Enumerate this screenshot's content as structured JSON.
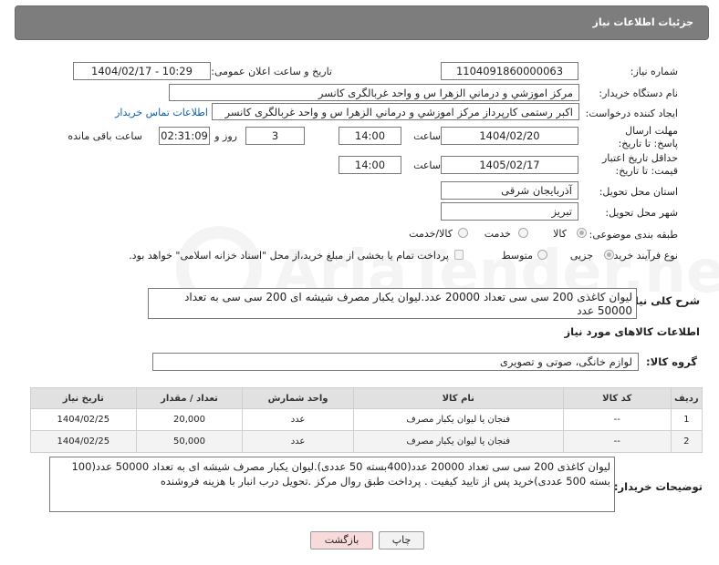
{
  "header": {
    "title": "جزئیات اطلاعات نیاز"
  },
  "fields": {
    "need_number_label": "شماره نیاز:",
    "need_number": "1104091860000063",
    "announce_label": "تاریخ و ساعت اعلان عمومی:",
    "announce_value": "1404/02/17 - 10:29",
    "buyer_org_label": "نام دستگاه خریدار:",
    "buyer_org": "مرکز اموزشي و درماني الزهرا س  و واحد غربالگری کانسر",
    "requester_label": "ایجاد کننده درخواست:",
    "requester": "اکبر رستمی کارپرداز مرکز اموزشي و درماني الزهرا س  و واحد غربالگری کانسر",
    "buyer_contact_link": "اطلاعات تماس خریدار",
    "deadline_label": "مهلت ارسال پاسخ: تا تاریخ:",
    "deadline_date": "1404/02/20",
    "time_label": "ساعت",
    "deadline_time": "14:00",
    "days_value": "3",
    "days_label": "روز و",
    "remaining_value": "02:31:09",
    "remaining_label": "ساعت باقی مانده",
    "price_validity_label": "حداقل تاریخ اعتبار قیمت: تا تاریخ:",
    "price_validity_date": "1405/02/17",
    "price_validity_time": "14:00",
    "province_label": "استان محل تحویل:",
    "province": "آذربایجان شرقی",
    "city_label": "شهر محل تحویل:",
    "city": "تبریز",
    "category_label": "طبقه بندی موضوعی:",
    "category_options": [
      "کالا",
      "خدمت",
      "کالا/خدمت"
    ],
    "category_selected": "کالا",
    "process_label": "نوع فرآیند خرید :",
    "process_options": [
      "جزیی",
      "متوسط"
    ],
    "process_selected": "جزیی",
    "payment_note": "پرداخت تمام یا بخشی از مبلغ خرید،از محل \"اسناد خزانه اسلامی\" خواهد بود."
  },
  "description": {
    "label": "شرح کلی نیاز:",
    "text": "لیوان کاغذی 200 سی سی تعداد 20000 عدد.لیوان یکبار مصرف شیشه ای 200 سی سی به تعداد 50000 عدد"
  },
  "goods_section": {
    "title": "اطلاعات کالاهای مورد نیاز",
    "group_label": "گروه کالا:",
    "group_value": "لوازم خانگی، صوتی و تصویری"
  },
  "table": {
    "headers": [
      "ردیف",
      "کد کالا",
      "نام کالا",
      "واحد شمارش",
      "تعداد / مقدار",
      "تاریخ نیاز"
    ],
    "rows": [
      [
        "1",
        "--",
        "فنجان یا لیوان یکبار مصرف",
        "عدد",
        "20,000",
        "1404/02/25"
      ],
      [
        "2",
        "--",
        "فنجان یا لیوان یکبار مصرف",
        "عدد",
        "50,000",
        "1404/02/25"
      ]
    ]
  },
  "buyer_notes": {
    "label": "توضیحات خریدار:",
    "text": "لیوان کاغذی 200 سی سی تعداد 20000 عدد(400بسته 50 عددی).لیوان یکبار مصرف شیشه ای به تعداد 50000 عدد(100 بسته 500 عددی)خرید پس از تایید کیفیت . پرداخت طبق روال مرکز .تحویل درب انبار با هزینه فروشنده"
  },
  "buttons": {
    "print": "چاپ",
    "back": "بازگشت"
  },
  "watermark": "AriaTender.neT",
  "colors": {
    "header_bg": "#7d7d7d",
    "link": "#0a5fb4",
    "back_button_bg": "#f8dada",
    "table_header_bg": "#e1e1e1"
  }
}
